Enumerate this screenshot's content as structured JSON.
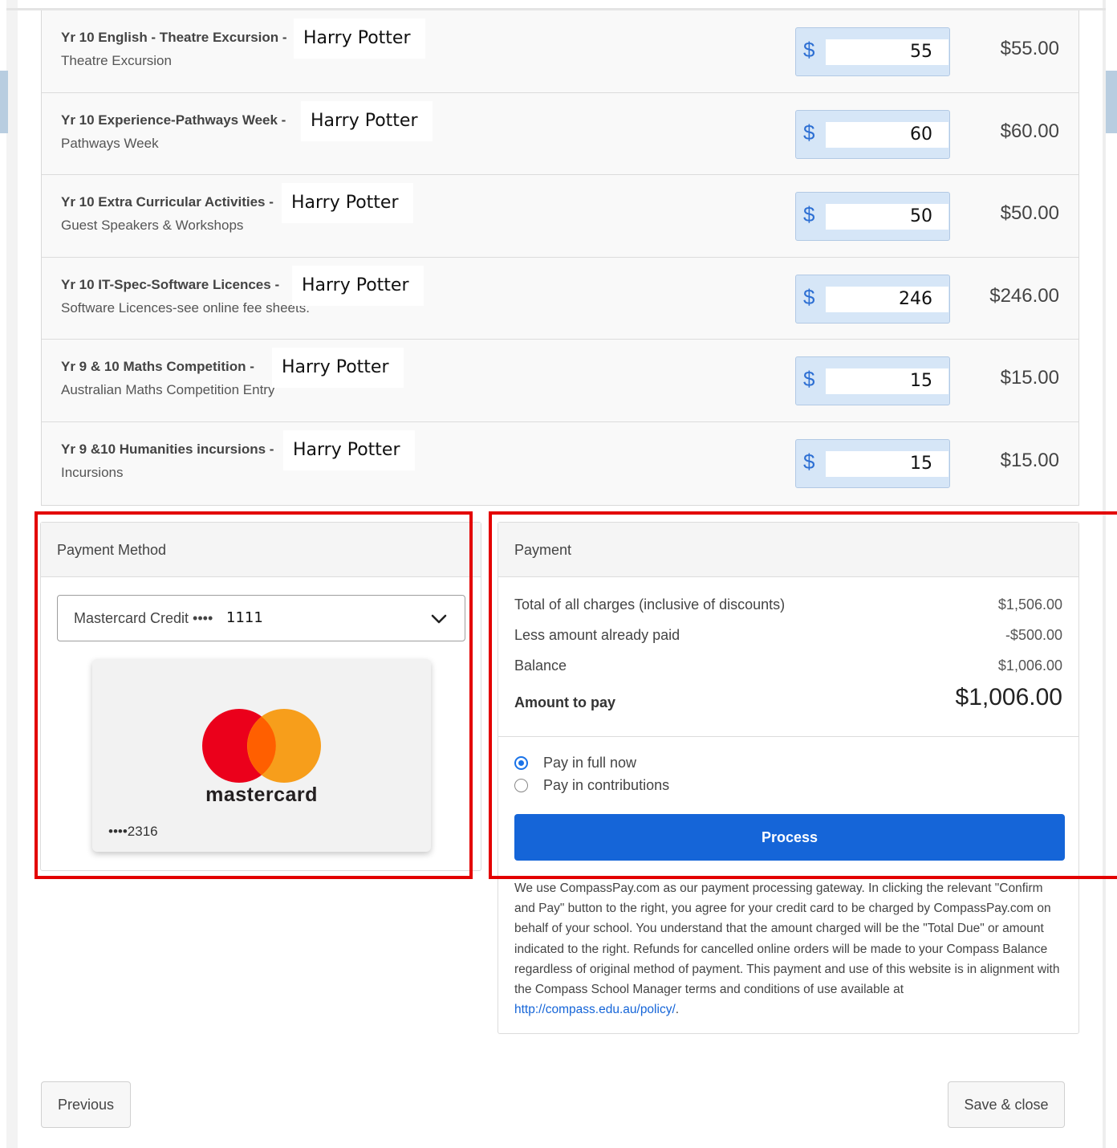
{
  "fees": [
    {
      "title": "Yr 10 English - Theatre Excursion -",
      "subtitle": "Theatre Excursion",
      "student": "Harry Potter",
      "currency": "$",
      "amount": "55",
      "total": "$55.00"
    },
    {
      "title": "Yr 10 Experience-Pathways Week -",
      "subtitle": "Pathways Week",
      "student": "Harry Potter",
      "currency": "$",
      "amount": "60",
      "total": "$60.00"
    },
    {
      "title": "Yr 10 Extra Curricular Activities -",
      "subtitle": "Guest Speakers & Workshops",
      "student": "Harry Potter",
      "currency": "$",
      "amount": "50",
      "total": "$50.00"
    },
    {
      "title": "Yr 10 IT-Spec-Software Licences -",
      "subtitle": "Software Licences-see online fee sheets.",
      "student": "Harry Potter",
      "currency": "$",
      "amount": "246",
      "total": "$246.00"
    },
    {
      "title": "Yr 9 & 10 Maths Competition -",
      "subtitle": "Australian Maths Competition Entry",
      "student": "Harry Potter",
      "currency": "$",
      "amount": "15",
      "total": "$15.00"
    },
    {
      "title": "Yr 9 &10 Humanities incursions -",
      "subtitle": "Incursions",
      "student": "Harry Potter",
      "currency": "$",
      "amount": "15",
      "total": "$15.00"
    }
  ],
  "payment_method": {
    "heading": "Payment Method",
    "selected_label": "Mastercard Credit ••••",
    "selected_last4": "1111",
    "card_brand": "mastercard",
    "card_number": "••••2316",
    "chevron_icon": "chevron-down-icon",
    "brand_colors": {
      "red": "#eb001b",
      "orange": "#f79e1b",
      "overlap": "#ff5f00"
    }
  },
  "payment": {
    "heading": "Payment",
    "summary": [
      {
        "label": "Total of all charges (inclusive of discounts)",
        "value": "$1,506.00"
      },
      {
        "label": "Less amount already paid",
        "value": "-$500.00"
      },
      {
        "label": "Balance",
        "value": "$1,006.00"
      }
    ],
    "amount_to_pay_label": "Amount to pay",
    "amount_to_pay_value": "$1,006.00",
    "options": [
      {
        "label": "Pay in full now",
        "selected": true
      },
      {
        "label": "Pay in contributions",
        "selected": false
      }
    ],
    "process_label": "Process",
    "disclaimer": "We use CompassPay.com as our payment processing gateway. In clicking the relevant \"Confirm and Pay\" button to the right, you agree for your credit card to be charged by CompassPay.com on behalf of your school. You understand that the amount charged will be the \"Total Due\" or amount indicated to the right. Refunds for cancelled online orders will be made to your Compass Balance regardless of original method of payment. This payment and use of this website is in alignment with the Compass School Manager terms and conditions of use available at",
    "policy_link": "http://compass.edu.au/policy/",
    "policy_link_suffix": "."
  },
  "footer": {
    "previous_label": "Previous",
    "save_close_label": "Save & close"
  },
  "colors": {
    "primary": "#1565d8",
    "highlight": "#e30000",
    "amount_box": "#d6e6f7"
  }
}
